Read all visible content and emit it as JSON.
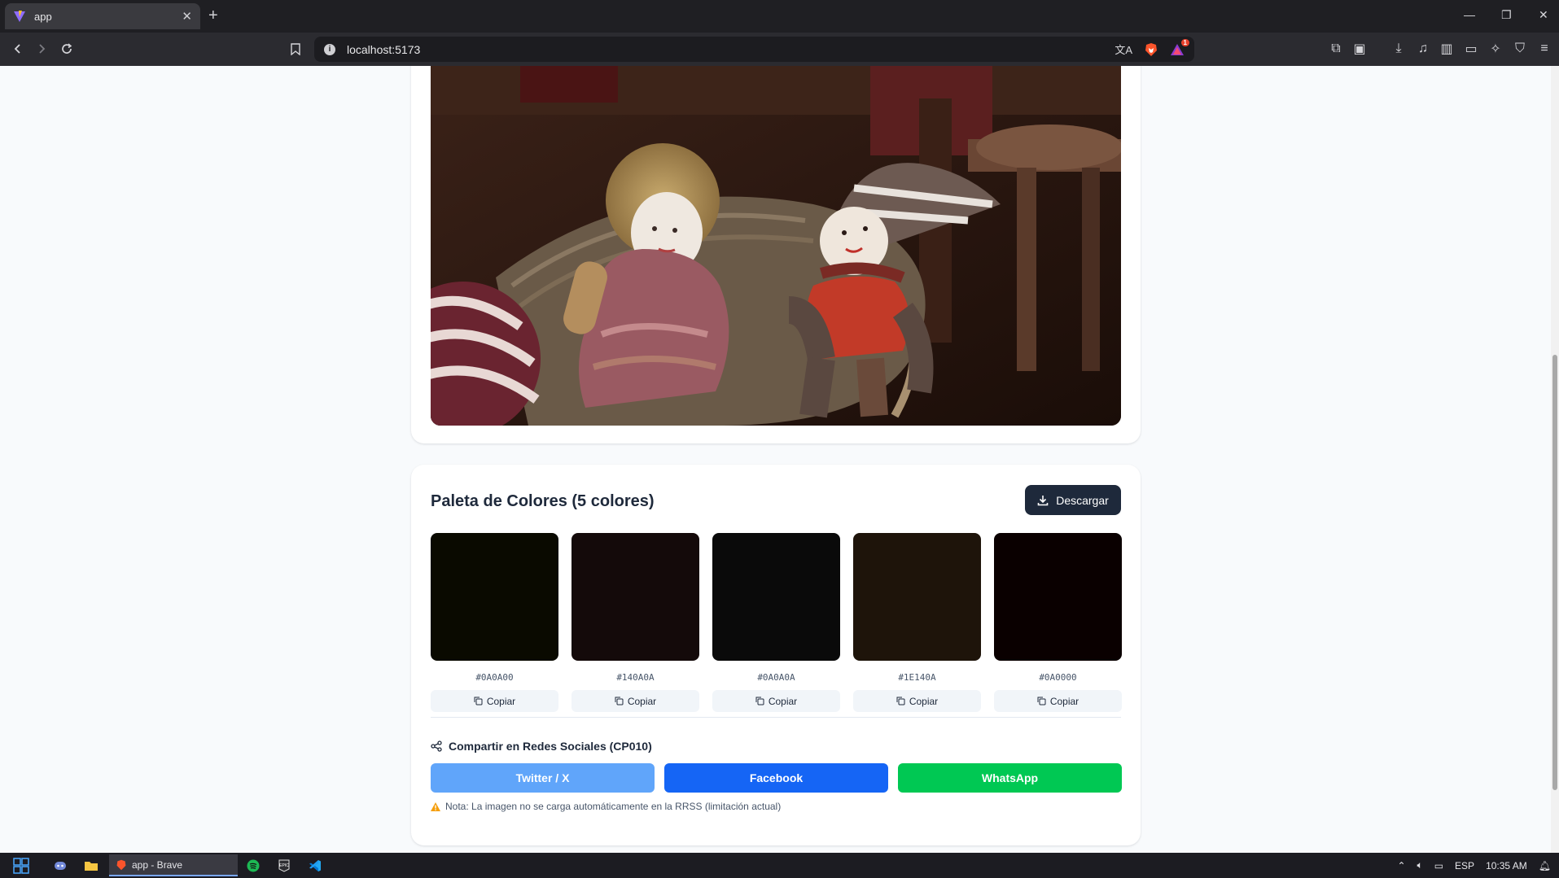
{
  "browser": {
    "tab_title": "app",
    "new_tab_symbol": "+",
    "url": "localhost:5173",
    "notification_count": "1"
  },
  "palette": {
    "title": "Paleta de Colores (5 colores)",
    "download_label": "Descargar",
    "copy_label": "Copiar",
    "colors": [
      {
        "hex": "#0A0A00"
      },
      {
        "hex": "#140A0A"
      },
      {
        "hex": "#0A0A0A"
      },
      {
        "hex": "#1E140A"
      },
      {
        "hex": "#0A0000"
      }
    ]
  },
  "share": {
    "title": "Compartir en Redes Sociales (CP010)",
    "twitter_label": "Twitter / X",
    "facebook_label": "Facebook",
    "whatsapp_label": "WhatsApp",
    "twitter_color": "#60a5fa",
    "facebook_color": "#1565f5",
    "whatsapp_color": "#00c853",
    "note": "Nota: La imagen no se carga automáticamente en la RRSS (limitación actual)"
  },
  "taskbar": {
    "active_app_label": "app - Brave",
    "language": "ESP",
    "time": "10:35 AM"
  }
}
